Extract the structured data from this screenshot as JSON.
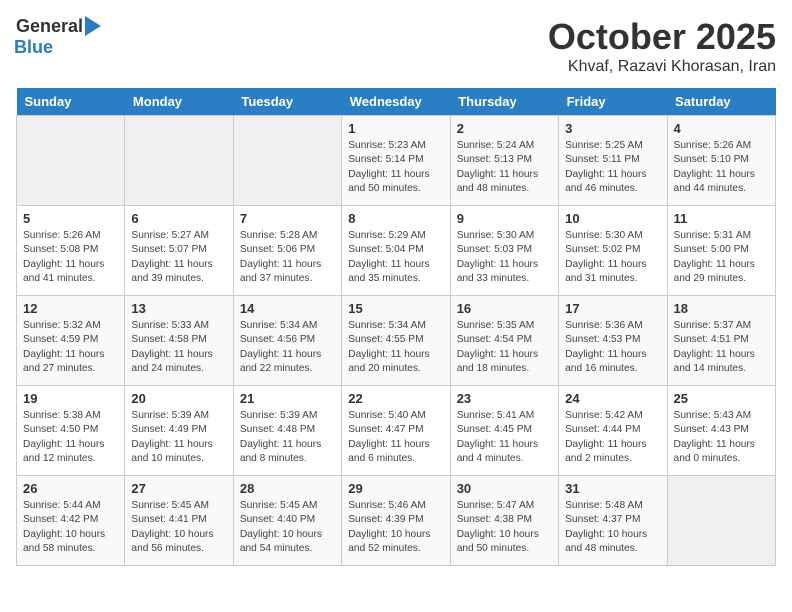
{
  "header": {
    "logo_general": "General",
    "logo_blue": "Blue",
    "month": "October 2025",
    "location": "Khvaf, Razavi Khorasan, Iran"
  },
  "days_of_week": [
    "Sunday",
    "Monday",
    "Tuesday",
    "Wednesday",
    "Thursday",
    "Friday",
    "Saturday"
  ],
  "weeks": [
    [
      {
        "day": "",
        "content": ""
      },
      {
        "day": "",
        "content": ""
      },
      {
        "day": "",
        "content": ""
      },
      {
        "day": "1",
        "content": "Sunrise: 5:23 AM\nSunset: 5:14 PM\nDaylight: 11 hours\nand 50 minutes."
      },
      {
        "day": "2",
        "content": "Sunrise: 5:24 AM\nSunset: 5:13 PM\nDaylight: 11 hours\nand 48 minutes."
      },
      {
        "day": "3",
        "content": "Sunrise: 5:25 AM\nSunset: 5:11 PM\nDaylight: 11 hours\nand 46 minutes."
      },
      {
        "day": "4",
        "content": "Sunrise: 5:26 AM\nSunset: 5:10 PM\nDaylight: 11 hours\nand 44 minutes."
      }
    ],
    [
      {
        "day": "5",
        "content": "Sunrise: 5:26 AM\nSunset: 5:08 PM\nDaylight: 11 hours\nand 41 minutes."
      },
      {
        "day": "6",
        "content": "Sunrise: 5:27 AM\nSunset: 5:07 PM\nDaylight: 11 hours\nand 39 minutes."
      },
      {
        "day": "7",
        "content": "Sunrise: 5:28 AM\nSunset: 5:06 PM\nDaylight: 11 hours\nand 37 minutes."
      },
      {
        "day": "8",
        "content": "Sunrise: 5:29 AM\nSunset: 5:04 PM\nDaylight: 11 hours\nand 35 minutes."
      },
      {
        "day": "9",
        "content": "Sunrise: 5:30 AM\nSunset: 5:03 PM\nDaylight: 11 hours\nand 33 minutes."
      },
      {
        "day": "10",
        "content": "Sunrise: 5:30 AM\nSunset: 5:02 PM\nDaylight: 11 hours\nand 31 minutes."
      },
      {
        "day": "11",
        "content": "Sunrise: 5:31 AM\nSunset: 5:00 PM\nDaylight: 11 hours\nand 29 minutes."
      }
    ],
    [
      {
        "day": "12",
        "content": "Sunrise: 5:32 AM\nSunset: 4:59 PM\nDaylight: 11 hours\nand 27 minutes."
      },
      {
        "day": "13",
        "content": "Sunrise: 5:33 AM\nSunset: 4:58 PM\nDaylight: 11 hours\nand 24 minutes."
      },
      {
        "day": "14",
        "content": "Sunrise: 5:34 AM\nSunset: 4:56 PM\nDaylight: 11 hours\nand 22 minutes."
      },
      {
        "day": "15",
        "content": "Sunrise: 5:34 AM\nSunset: 4:55 PM\nDaylight: 11 hours\nand 20 minutes."
      },
      {
        "day": "16",
        "content": "Sunrise: 5:35 AM\nSunset: 4:54 PM\nDaylight: 11 hours\nand 18 minutes."
      },
      {
        "day": "17",
        "content": "Sunrise: 5:36 AM\nSunset: 4:53 PM\nDaylight: 11 hours\nand 16 minutes."
      },
      {
        "day": "18",
        "content": "Sunrise: 5:37 AM\nSunset: 4:51 PM\nDaylight: 11 hours\nand 14 minutes."
      }
    ],
    [
      {
        "day": "19",
        "content": "Sunrise: 5:38 AM\nSunset: 4:50 PM\nDaylight: 11 hours\nand 12 minutes."
      },
      {
        "day": "20",
        "content": "Sunrise: 5:39 AM\nSunset: 4:49 PM\nDaylight: 11 hours\nand 10 minutes."
      },
      {
        "day": "21",
        "content": "Sunrise: 5:39 AM\nSunset: 4:48 PM\nDaylight: 11 hours\nand 8 minutes."
      },
      {
        "day": "22",
        "content": "Sunrise: 5:40 AM\nSunset: 4:47 PM\nDaylight: 11 hours\nand 6 minutes."
      },
      {
        "day": "23",
        "content": "Sunrise: 5:41 AM\nSunset: 4:45 PM\nDaylight: 11 hours\nand 4 minutes."
      },
      {
        "day": "24",
        "content": "Sunrise: 5:42 AM\nSunset: 4:44 PM\nDaylight: 11 hours\nand 2 minutes."
      },
      {
        "day": "25",
        "content": "Sunrise: 5:43 AM\nSunset: 4:43 PM\nDaylight: 11 hours\nand 0 minutes."
      }
    ],
    [
      {
        "day": "26",
        "content": "Sunrise: 5:44 AM\nSunset: 4:42 PM\nDaylight: 10 hours\nand 58 minutes."
      },
      {
        "day": "27",
        "content": "Sunrise: 5:45 AM\nSunset: 4:41 PM\nDaylight: 10 hours\nand 56 minutes."
      },
      {
        "day": "28",
        "content": "Sunrise: 5:45 AM\nSunset: 4:40 PM\nDaylight: 10 hours\nand 54 minutes."
      },
      {
        "day": "29",
        "content": "Sunrise: 5:46 AM\nSunset: 4:39 PM\nDaylight: 10 hours\nand 52 minutes."
      },
      {
        "day": "30",
        "content": "Sunrise: 5:47 AM\nSunset: 4:38 PM\nDaylight: 10 hours\nand 50 minutes."
      },
      {
        "day": "31",
        "content": "Sunrise: 5:48 AM\nSunset: 4:37 PM\nDaylight: 10 hours\nand 48 minutes."
      },
      {
        "day": "",
        "content": ""
      }
    ]
  ]
}
